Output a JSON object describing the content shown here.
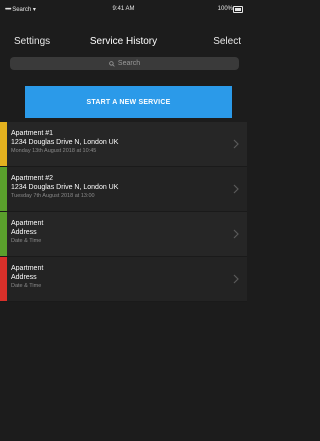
{
  "status_bar": {
    "carrier": "Search",
    "signal": "•••••",
    "time": "9:41 AM",
    "battery": "100%"
  },
  "nav": {
    "left": "Settings",
    "title": "Service History",
    "right": "Select"
  },
  "search": {
    "placeholder": "Search"
  },
  "start_button": {
    "label": "START A NEW SERVICE",
    "color": "#2b9ae9"
  },
  "services": [
    {
      "title": "Apartment #1",
      "address": "1234 Douglas Drive N, London UK",
      "date": "Monday 13th August 2018 at 10:45",
      "status_color": "#e3b11f"
    },
    {
      "title": "Apartment #2",
      "address": "1234 Douglas Drive N, London UK",
      "date": "Tuesday 7th August 2018 at 13:00",
      "status_color": "#5aa02c"
    },
    {
      "title": "Apartment",
      "address": "Address",
      "date": "Date & Time",
      "status_color": "#5aa02c"
    },
    {
      "title": "Apartment",
      "address": "Address",
      "date": "Date & Time",
      "status_color": "#d9302a"
    }
  ]
}
